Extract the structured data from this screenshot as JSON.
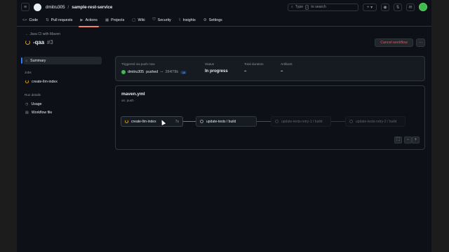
{
  "header": {
    "owner": "dmitru305",
    "separator": "/",
    "repo": "sample-rest-service",
    "search_prefix": "Type",
    "search_key": "/",
    "search_suffix": "to search",
    "icons": [
      "menu-icon",
      "github-logo-icon",
      "plus-icon",
      "issues-icon",
      "pull-requests-icon",
      "inbox-icon",
      "avatar"
    ]
  },
  "tabs": [
    {
      "label": "Code",
      "icon": "<>"
    },
    {
      "label": "Pull requests",
      "icon": "⇅"
    },
    {
      "label": "Actions",
      "icon": "▶",
      "active": true
    },
    {
      "label": "Projects",
      "icon": "▦"
    },
    {
      "label": "Wiki",
      "icon": "▢"
    },
    {
      "label": "Security",
      "icon": "⛉"
    },
    {
      "label": "Insights",
      "icon": "⌇"
    },
    {
      "label": "Settings",
      "icon": "⚙"
    }
  ],
  "run": {
    "back_label": "Java CI with Maven",
    "title": "-qaa",
    "number": "#3",
    "cancel_label": "Cancel workflow",
    "more_label": "···"
  },
  "sidebar": {
    "summary_label": "Summary",
    "jobs_heading": "Jobs",
    "jobs": [
      "create-llm-index"
    ],
    "run_details_heading": "Run details",
    "details": [
      {
        "label": "Usage",
        "icon": "◷"
      },
      {
        "label": "Workflow file",
        "icon": "▤"
      }
    ]
  },
  "summary": {
    "trigger_caption": "Triggered via push now",
    "actor": "dmitru305",
    "action": "pushed",
    "sha": "284f78b",
    "branch": "qa",
    "status_caption": "Status",
    "status_value": "In progress",
    "duration_caption": "Total duration",
    "duration_value": "–",
    "artifacts_caption": "Artifacts",
    "artifacts_value": "–"
  },
  "workflow": {
    "file": "maven.yml",
    "trigger": "on: push",
    "jobs": [
      {
        "name": "create-llm-index",
        "time": "7s",
        "state": "running"
      },
      {
        "name": "update-tests / build",
        "time": "",
        "state": "queued"
      },
      {
        "name": "update-tests-retry-1 / build",
        "time": "",
        "state": "pending"
      },
      {
        "name": "update-tests-retry-2 / build",
        "time": "",
        "state": "pending"
      }
    ],
    "zoom_fit": "⛶",
    "zoom_out": "−",
    "zoom_in": "+"
  },
  "colors": {
    "accent": "#2f81f7",
    "running": "#d29922",
    "danger": "#f85149",
    "tab_underline": "#f78166"
  }
}
